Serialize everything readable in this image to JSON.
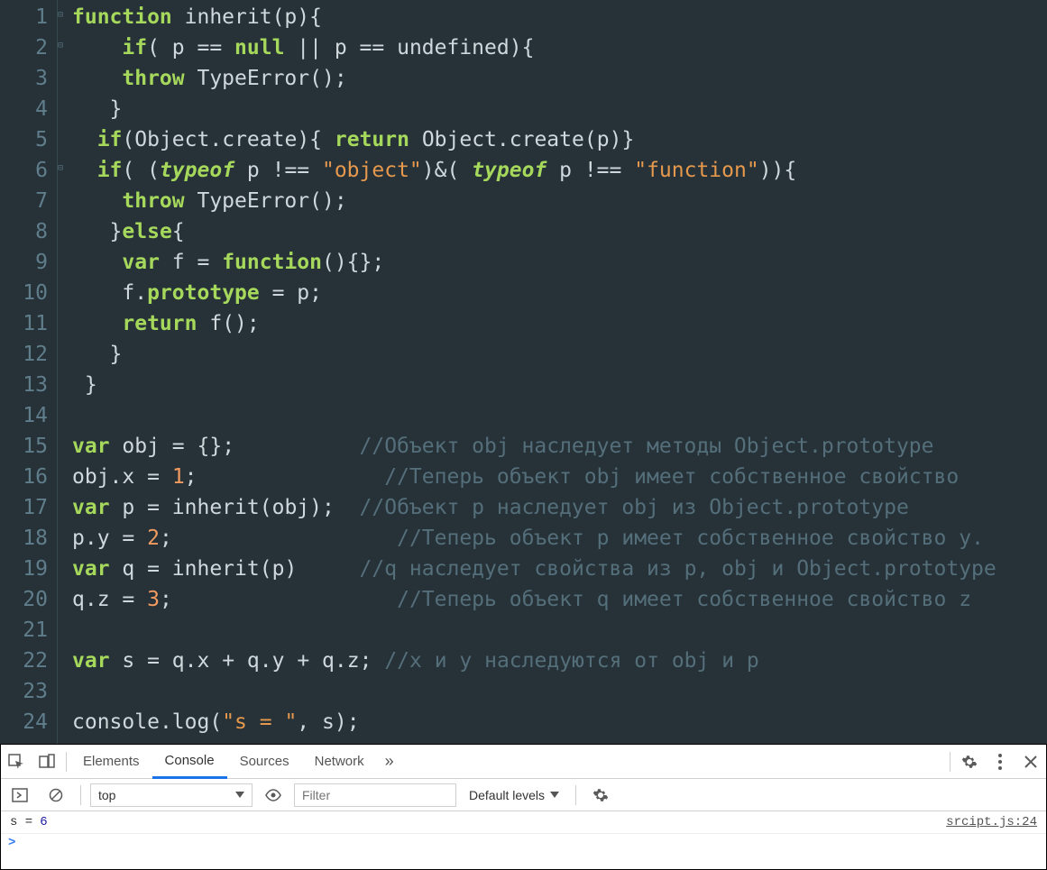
{
  "editor": {
    "line_count": 24,
    "lines": [
      {
        "n": 1,
        "tokens": [
          [
            "kw",
            "function"
          ],
          [
            "plain",
            " inherit"
          ],
          [
            "punct",
            "("
          ],
          [
            "plain",
            "p"
          ],
          [
            "punct",
            ")"
          ],
          [
            "punct",
            "{"
          ]
        ]
      },
      {
        "n": 2,
        "tokens": [
          [
            "plain",
            "    "
          ],
          [
            "kw",
            "if"
          ],
          [
            "punct",
            "( "
          ],
          [
            "plain",
            "p "
          ],
          [
            "punct",
            "== "
          ],
          [
            "kw",
            "null"
          ],
          [
            "plain",
            " "
          ],
          [
            "punct",
            "|| "
          ],
          [
            "plain",
            "p "
          ],
          [
            "punct",
            "== "
          ],
          [
            "plain",
            "undefined"
          ],
          [
            "punct",
            ")"
          ],
          [
            "punct",
            "{"
          ]
        ]
      },
      {
        "n": 3,
        "tokens": [
          [
            "plain",
            "    "
          ],
          [
            "kw",
            "throw"
          ],
          [
            "plain",
            " TypeError"
          ],
          [
            "punct",
            "();"
          ]
        ]
      },
      {
        "n": 4,
        "tokens": [
          [
            "plain",
            "   "
          ],
          [
            "punct",
            "}"
          ]
        ]
      },
      {
        "n": 5,
        "tokens": [
          [
            "plain",
            "  "
          ],
          [
            "kw",
            "if"
          ],
          [
            "punct",
            "("
          ],
          [
            "plain",
            "Object"
          ],
          [
            "punct",
            "."
          ],
          [
            "plain",
            "create"
          ],
          [
            "punct",
            ")"
          ],
          [
            "punct",
            "{ "
          ],
          [
            "kw",
            "return"
          ],
          [
            "plain",
            " Object"
          ],
          [
            "punct",
            "."
          ],
          [
            "plain",
            "create"
          ],
          [
            "punct",
            "("
          ],
          [
            "plain",
            "p"
          ],
          [
            "punct",
            ")"
          ],
          [
            "punct",
            "}"
          ]
        ]
      },
      {
        "n": 6,
        "tokens": [
          [
            "plain",
            "  "
          ],
          [
            "kw",
            "if"
          ],
          [
            "punct",
            "( ("
          ],
          [
            "kw2",
            "typeof"
          ],
          [
            "plain",
            " p "
          ],
          [
            "punct",
            "!== "
          ],
          [
            "str",
            "\"object\""
          ],
          [
            "punct",
            ")"
          ],
          [
            "punct",
            "&"
          ],
          [
            "punct",
            "( "
          ],
          [
            "kw2",
            "typeof"
          ],
          [
            "plain",
            " p "
          ],
          [
            "punct",
            "!== "
          ],
          [
            "str",
            "\"function\""
          ],
          [
            "punct",
            "))"
          ],
          [
            "punct",
            "{"
          ]
        ]
      },
      {
        "n": 7,
        "tokens": [
          [
            "plain",
            "    "
          ],
          [
            "kw",
            "throw"
          ],
          [
            "plain",
            " TypeError"
          ],
          [
            "punct",
            "();"
          ]
        ]
      },
      {
        "n": 8,
        "tokens": [
          [
            "plain",
            "   "
          ],
          [
            "punct",
            "}"
          ],
          [
            "kw",
            "else"
          ],
          [
            "punct",
            "{"
          ]
        ]
      },
      {
        "n": 9,
        "tokens": [
          [
            "plain",
            "    "
          ],
          [
            "kw",
            "var"
          ],
          [
            "plain",
            " f "
          ],
          [
            "punct",
            "= "
          ],
          [
            "kw",
            "function"
          ],
          [
            "punct",
            "()"
          ],
          [
            "punct",
            "{};"
          ]
        ]
      },
      {
        "n": 10,
        "tokens": [
          [
            "plain",
            "    f"
          ],
          [
            "punct",
            "."
          ],
          [
            "prop",
            "prototype"
          ],
          [
            "plain",
            " "
          ],
          [
            "punct",
            "= "
          ],
          [
            "plain",
            "p"
          ],
          [
            "punct",
            ";"
          ]
        ]
      },
      {
        "n": 11,
        "tokens": [
          [
            "plain",
            "    "
          ],
          [
            "kw",
            "return"
          ],
          [
            "plain",
            " f"
          ],
          [
            "punct",
            "();"
          ]
        ]
      },
      {
        "n": 12,
        "tokens": [
          [
            "plain",
            "   "
          ],
          [
            "punct",
            "}"
          ]
        ]
      },
      {
        "n": 13,
        "tokens": [
          [
            "plain",
            " "
          ],
          [
            "punct",
            "}"
          ]
        ]
      },
      {
        "n": 14,
        "tokens": [
          [
            "plain",
            ""
          ]
        ]
      },
      {
        "n": 15,
        "tokens": [
          [
            "kw",
            "var"
          ],
          [
            "plain",
            " obj "
          ],
          [
            "punct",
            "= "
          ],
          [
            "punct",
            "{};          "
          ],
          [
            "cmt",
            "//Объект obj наследует методы Object.prototype"
          ]
        ]
      },
      {
        "n": 16,
        "tokens": [
          [
            "plain",
            "obj"
          ],
          [
            "punct",
            "."
          ],
          [
            "plain",
            "x "
          ],
          [
            "punct",
            "= "
          ],
          [
            "num",
            "1"
          ],
          [
            "punct",
            ";               "
          ],
          [
            "cmt",
            "//Теперь объект obj имеет собственное свойство"
          ]
        ]
      },
      {
        "n": 17,
        "tokens": [
          [
            "kw",
            "var"
          ],
          [
            "plain",
            " p "
          ],
          [
            "punct",
            "= "
          ],
          [
            "plain",
            "inherit"
          ],
          [
            "punct",
            "("
          ],
          [
            "plain",
            "obj"
          ],
          [
            "punct",
            ");  "
          ],
          [
            "cmt",
            "//Объект p наследует obj из Object.prototype"
          ]
        ]
      },
      {
        "n": 18,
        "tokens": [
          [
            "plain",
            "p"
          ],
          [
            "punct",
            "."
          ],
          [
            "plain",
            "y "
          ],
          [
            "punct",
            "= "
          ],
          [
            "num",
            "2"
          ],
          [
            "punct",
            ";                  "
          ],
          [
            "cmt",
            "//Теперь объект p имеет собственное свойство y."
          ]
        ]
      },
      {
        "n": 19,
        "tokens": [
          [
            "kw",
            "var"
          ],
          [
            "plain",
            " q "
          ],
          [
            "punct",
            "= "
          ],
          [
            "plain",
            "inherit"
          ],
          [
            "punct",
            "("
          ],
          [
            "plain",
            "p"
          ],
          [
            "punct",
            ")     "
          ],
          [
            "cmt",
            "//q наследует свойства из p, obj и Object.prototype"
          ]
        ]
      },
      {
        "n": 20,
        "tokens": [
          [
            "plain",
            "q"
          ],
          [
            "punct",
            "."
          ],
          [
            "plain",
            "z "
          ],
          [
            "punct",
            "= "
          ],
          [
            "num",
            "3"
          ],
          [
            "punct",
            ";                  "
          ],
          [
            "cmt",
            "//Теперь объект q имеет собственное свойство z"
          ]
        ]
      },
      {
        "n": 21,
        "tokens": [
          [
            "plain",
            ""
          ]
        ]
      },
      {
        "n": 22,
        "tokens": [
          [
            "kw",
            "var"
          ],
          [
            "plain",
            " s "
          ],
          [
            "punct",
            "= "
          ],
          [
            "plain",
            "q"
          ],
          [
            "punct",
            "."
          ],
          [
            "plain",
            "x "
          ],
          [
            "punct",
            "+ "
          ],
          [
            "plain",
            "q"
          ],
          [
            "punct",
            "."
          ],
          [
            "plain",
            "y "
          ],
          [
            "punct",
            "+ "
          ],
          [
            "plain",
            "q"
          ],
          [
            "punct",
            "."
          ],
          [
            "plain",
            "z"
          ],
          [
            "punct",
            "; "
          ],
          [
            "cmt",
            "//x и y наследуются от obj и p"
          ]
        ]
      },
      {
        "n": 23,
        "tokens": [
          [
            "plain",
            ""
          ]
        ]
      },
      {
        "n": 24,
        "tokens": [
          [
            "plain",
            "console"
          ],
          [
            "punct",
            "."
          ],
          [
            "plain",
            "log"
          ],
          [
            "punct",
            "("
          ],
          [
            "str",
            "\"s = \""
          ],
          [
            "punct",
            ", "
          ],
          [
            "plain",
            "s"
          ],
          [
            "punct",
            ");"
          ]
        ]
      }
    ]
  },
  "devtools": {
    "tabs": {
      "elements": "Elements",
      "console": "Console",
      "sources": "Sources",
      "network": "Network"
    },
    "overflow": "»",
    "context_selector": "top",
    "filter_placeholder": "Filter",
    "levels_label": "Default levels",
    "log": {
      "label": "s = ",
      "value": "6",
      "source": "srcipt.js:24"
    },
    "prompt": ">"
  }
}
